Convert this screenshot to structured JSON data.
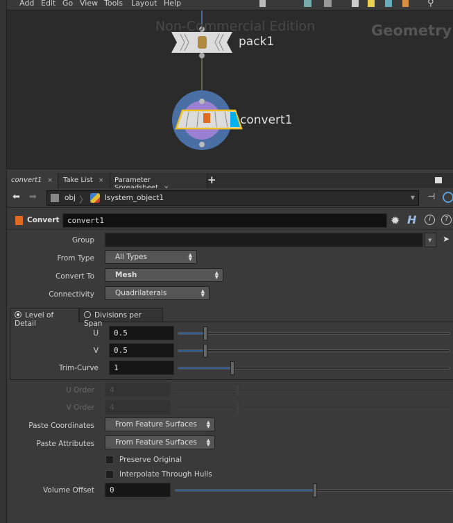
{
  "menubar": {
    "items": [
      "Add",
      "Edit",
      "Go",
      "View",
      "Tools",
      "Layout",
      "Help"
    ]
  },
  "network": {
    "watermark": "Non-Commercial Edition",
    "context_label": "Geometry",
    "nodes": [
      {
        "name": "pack1",
        "type": "pack"
      },
      {
        "name": "convert1",
        "type": "convert",
        "selected": true,
        "display_flag": true,
        "render_flag": true
      }
    ],
    "colors": {
      "input_wire": "#5a7fb8",
      "wire": "#9aa070",
      "display_ring": "#4a6fa5",
      "template_ring": "#9a80d0",
      "select_outline": "#f0c020",
      "flag_blue": "#00b0f0"
    }
  },
  "tabs": [
    {
      "label": "convert1",
      "active": true
    },
    {
      "label": "Take List"
    },
    {
      "label": "Parameter Spreadsheet"
    }
  ],
  "tab_add_label": "+",
  "path": {
    "root": "obj",
    "object": "lsystem_object1"
  },
  "node_header": {
    "type_label": "Convert",
    "name": "convert1"
  },
  "params": {
    "group": {
      "label": "Group",
      "value": ""
    },
    "from_type": {
      "label": "From Type",
      "value": "All Types"
    },
    "convert_to": {
      "label": "Convert To",
      "value": "Mesh"
    },
    "connectivity": {
      "label": "Connectivity",
      "value": "Quadrilaterals"
    },
    "detail_tabs": [
      {
        "label": "Level of Detail",
        "selected": true
      },
      {
        "label": "Divisions per Span",
        "selected": false
      }
    ],
    "u": {
      "label": "U",
      "value": "0.5",
      "slider_fraction": 0.1
    },
    "v": {
      "label": "V",
      "value": "0.5",
      "slider_fraction": 0.1
    },
    "trim_curve": {
      "label": "Trim-Curve",
      "value": "1",
      "slider_fraction": 0.2
    },
    "u_order": {
      "label": "U Order",
      "value": "4",
      "disabled": true
    },
    "v_order": {
      "label": "V Order",
      "value": "4",
      "disabled": true
    },
    "paste_coordinates": {
      "label": "Paste Coordinates",
      "value": "From Feature Surfaces"
    },
    "paste_attributes": {
      "label": "Paste Attributes",
      "value": "From Feature Surfaces"
    },
    "preserve_original": {
      "label": "Preserve Original",
      "checked": false
    },
    "interpolate_hulls": {
      "label": "Interpolate Through Hulls",
      "checked": false
    },
    "volume_offset": {
      "label": "Volume Offset",
      "value": "0",
      "slider_fraction": 0.5
    }
  }
}
